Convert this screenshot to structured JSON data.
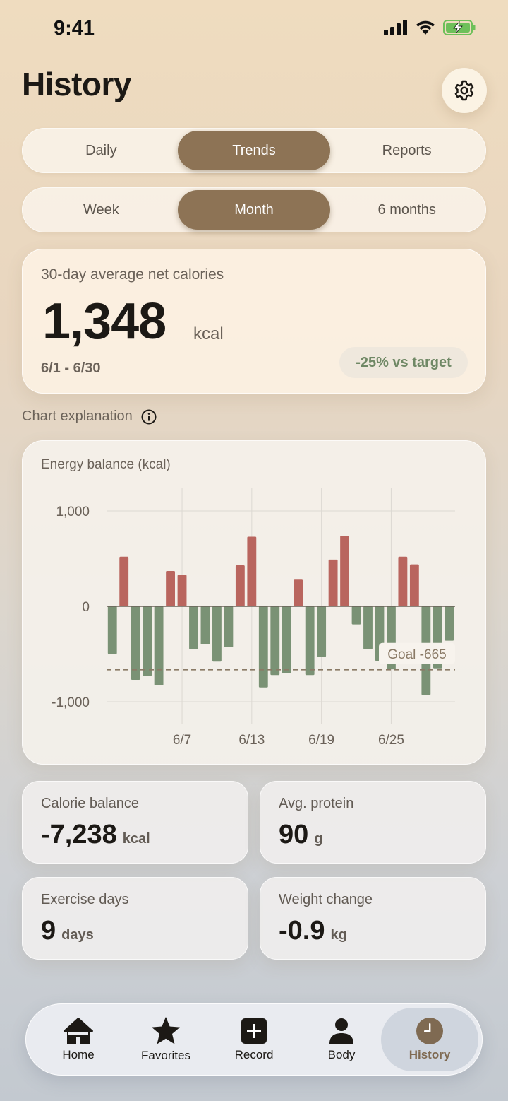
{
  "status_bar": {
    "time": "9:41"
  },
  "header": {
    "title": "History"
  },
  "view_tabs": [
    {
      "label": "Daily",
      "active": false
    },
    {
      "label": "Trends",
      "active": true
    },
    {
      "label": "Reports",
      "active": false
    }
  ],
  "range_tabs": [
    {
      "label": "Week",
      "active": false
    },
    {
      "label": "Month",
      "active": true
    },
    {
      "label": "6 months",
      "active": false
    }
  ],
  "summary": {
    "label": "30-day average net calories",
    "value": "1,348",
    "unit": "kcal",
    "range": "6/1 - 6/30",
    "badge": "-25% vs target"
  },
  "chart_explanation": {
    "label": "Chart explanation"
  },
  "chart_data": {
    "type": "bar",
    "title": "Energy balance (kcal)",
    "x": [
      "6/1",
      "6/2",
      "6/3",
      "6/4",
      "6/5",
      "6/6",
      "6/7",
      "6/8",
      "6/9",
      "6/10",
      "6/11",
      "6/12",
      "6/13",
      "6/14",
      "6/15",
      "6/16",
      "6/17",
      "6/18",
      "6/19",
      "6/20",
      "6/21",
      "6/22",
      "6/23",
      "6/24",
      "6/25",
      "6/26",
      "6/27",
      "6/28",
      "6/29",
      "6/30"
    ],
    "values": [
      -500,
      520,
      -770,
      -730,
      -830,
      370,
      330,
      -450,
      -400,
      -580,
      -430,
      430,
      730,
      -850,
      -720,
      -700,
      280,
      -720,
      -530,
      490,
      740,
      -190,
      -450,
      -570,
      -660,
      520,
      440,
      -930,
      -650,
      -360
    ],
    "x_ticks": [
      "6/7",
      "6/13",
      "6/19",
      "6/25"
    ],
    "y_ticks": [
      "1,000",
      "0",
      "-1,000"
    ],
    "y_tick_values": [
      1000,
      0,
      -1000
    ],
    "ylim": [
      -1000,
      1000
    ],
    "goal": {
      "value": -665,
      "label": "Goal -665"
    },
    "colors": {
      "positive": "#b9655e",
      "negative": "#7a9275",
      "goal": "#8a7a66"
    },
    "grid": true
  },
  "stats": [
    {
      "label": "Calorie balance",
      "value": "-7,238",
      "unit": "kcal"
    },
    {
      "label": "Avg. protein",
      "value": "90",
      "unit": "g"
    },
    {
      "label": "Exercise days",
      "value": "9",
      "unit": "days"
    },
    {
      "label": "Weight change",
      "value": "-0.9",
      "unit": "kg"
    }
  ],
  "tab_bar": [
    {
      "label": "Home",
      "icon": "home-icon",
      "active": false
    },
    {
      "label": "Favorites",
      "icon": "star-icon",
      "active": false
    },
    {
      "label": "Record",
      "icon": "plus-square-icon",
      "active": false
    },
    {
      "label": "Body",
      "icon": "person-icon",
      "active": false
    },
    {
      "label": "History",
      "icon": "clock-icon",
      "active": true
    }
  ]
}
